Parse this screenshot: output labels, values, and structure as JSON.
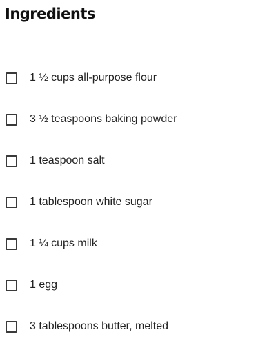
{
  "title": "Ingredients",
  "ingredients": [
    {
      "label": "1 ½ cups all-purpose flour",
      "checked": false
    },
    {
      "label": "3 ½ teaspoons baking powder",
      "checked": false
    },
    {
      "label": "1 teaspoon salt",
      "checked": false
    },
    {
      "label": "1 tablespoon white sugar",
      "checked": false
    },
    {
      "label": "1 ¼ cups milk",
      "checked": false
    },
    {
      "label": "1 egg",
      "checked": false
    },
    {
      "label": "3 tablespoons butter, melted",
      "checked": false
    }
  ]
}
